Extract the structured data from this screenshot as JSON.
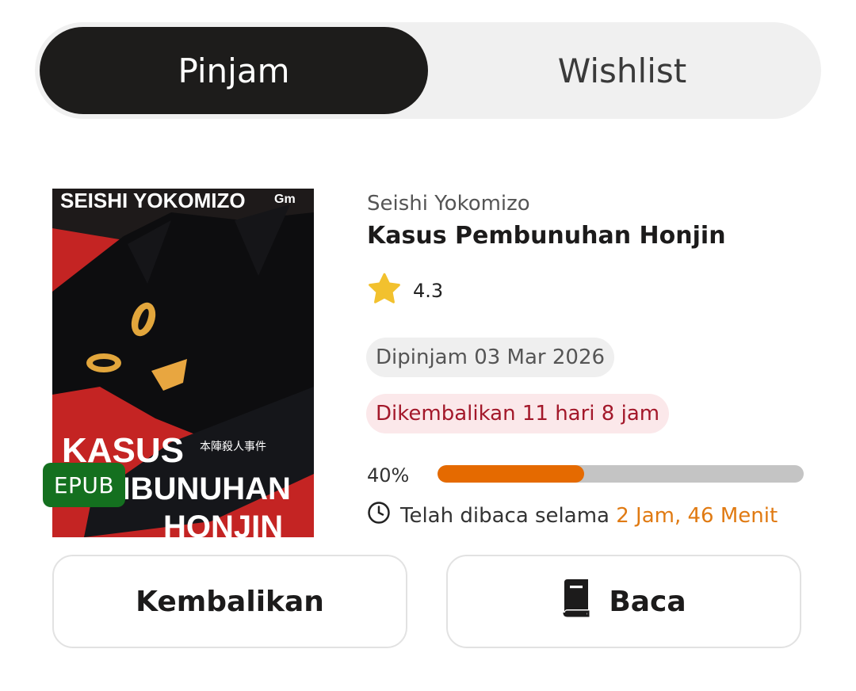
{
  "tabs": [
    {
      "label": "Pinjam",
      "active": true
    },
    {
      "label": "Wishlist",
      "active": false
    }
  ],
  "book": {
    "author": "Seishi Yokomizo",
    "title": "Kasus Pembunuhan Honjin",
    "rating": "4.3",
    "format_badge": "EPUB",
    "cover": {
      "author_text": "SEISHI YOKOMIZO",
      "title_text_1": "KASUS",
      "title_text_2": "PEMBUNUHAN",
      "title_text_3": "HONJIN",
      "japanese_text": "本陣殺人事件",
      "publisher_mark": "Gm"
    }
  },
  "loan": {
    "borrowed_text": "Dipinjam 03 Mar 2026",
    "due_text": "Dikembalikan 11 hari 8 jam"
  },
  "progress": {
    "label": "40%",
    "fraction": 0.4
  },
  "reading": {
    "prefix": "Telah dibaca selama",
    "duration": "2 Jam, 46 Menit"
  },
  "actions": {
    "return_label": "Kembalikan",
    "read_label": "Baca"
  },
  "icons": {
    "rating": "star-icon",
    "time": "clock-icon",
    "read": "book-icon"
  },
  "colors": {
    "active_tab": "#1d1c1b",
    "progress_fill": "#e56a00",
    "due_text": "#a3182a",
    "epub_badge": "#14701f",
    "star": "#f2c12e"
  }
}
